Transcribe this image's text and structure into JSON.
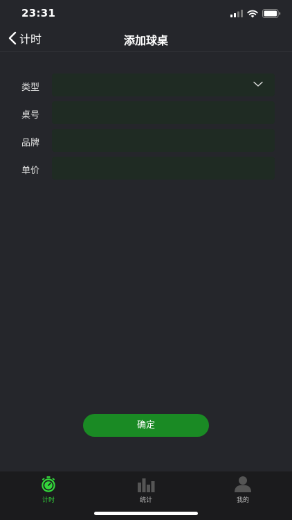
{
  "status_bar": {
    "time": "23:31"
  },
  "nav": {
    "back_label": "计时",
    "title": "添加球桌"
  },
  "form": {
    "rows": [
      {
        "label": "类型",
        "value": "",
        "type": "select"
      },
      {
        "label": "桌号",
        "value": "",
        "type": "text"
      },
      {
        "label": "品牌",
        "value": "",
        "type": "text"
      },
      {
        "label": "单价",
        "value": "",
        "type": "text"
      }
    ],
    "confirm_label": "确定"
  },
  "tabs": [
    {
      "label": "计时",
      "icon": "stopwatch-icon",
      "active": true
    },
    {
      "label": "统计",
      "icon": "bar-chart-icon",
      "active": false
    },
    {
      "label": "我的",
      "icon": "user-icon",
      "active": false
    }
  ],
  "colors": {
    "accent": "#33d63b",
    "button": "#1a8a24",
    "field_bg": "#1f2b23",
    "page_bg": "#25262b"
  }
}
